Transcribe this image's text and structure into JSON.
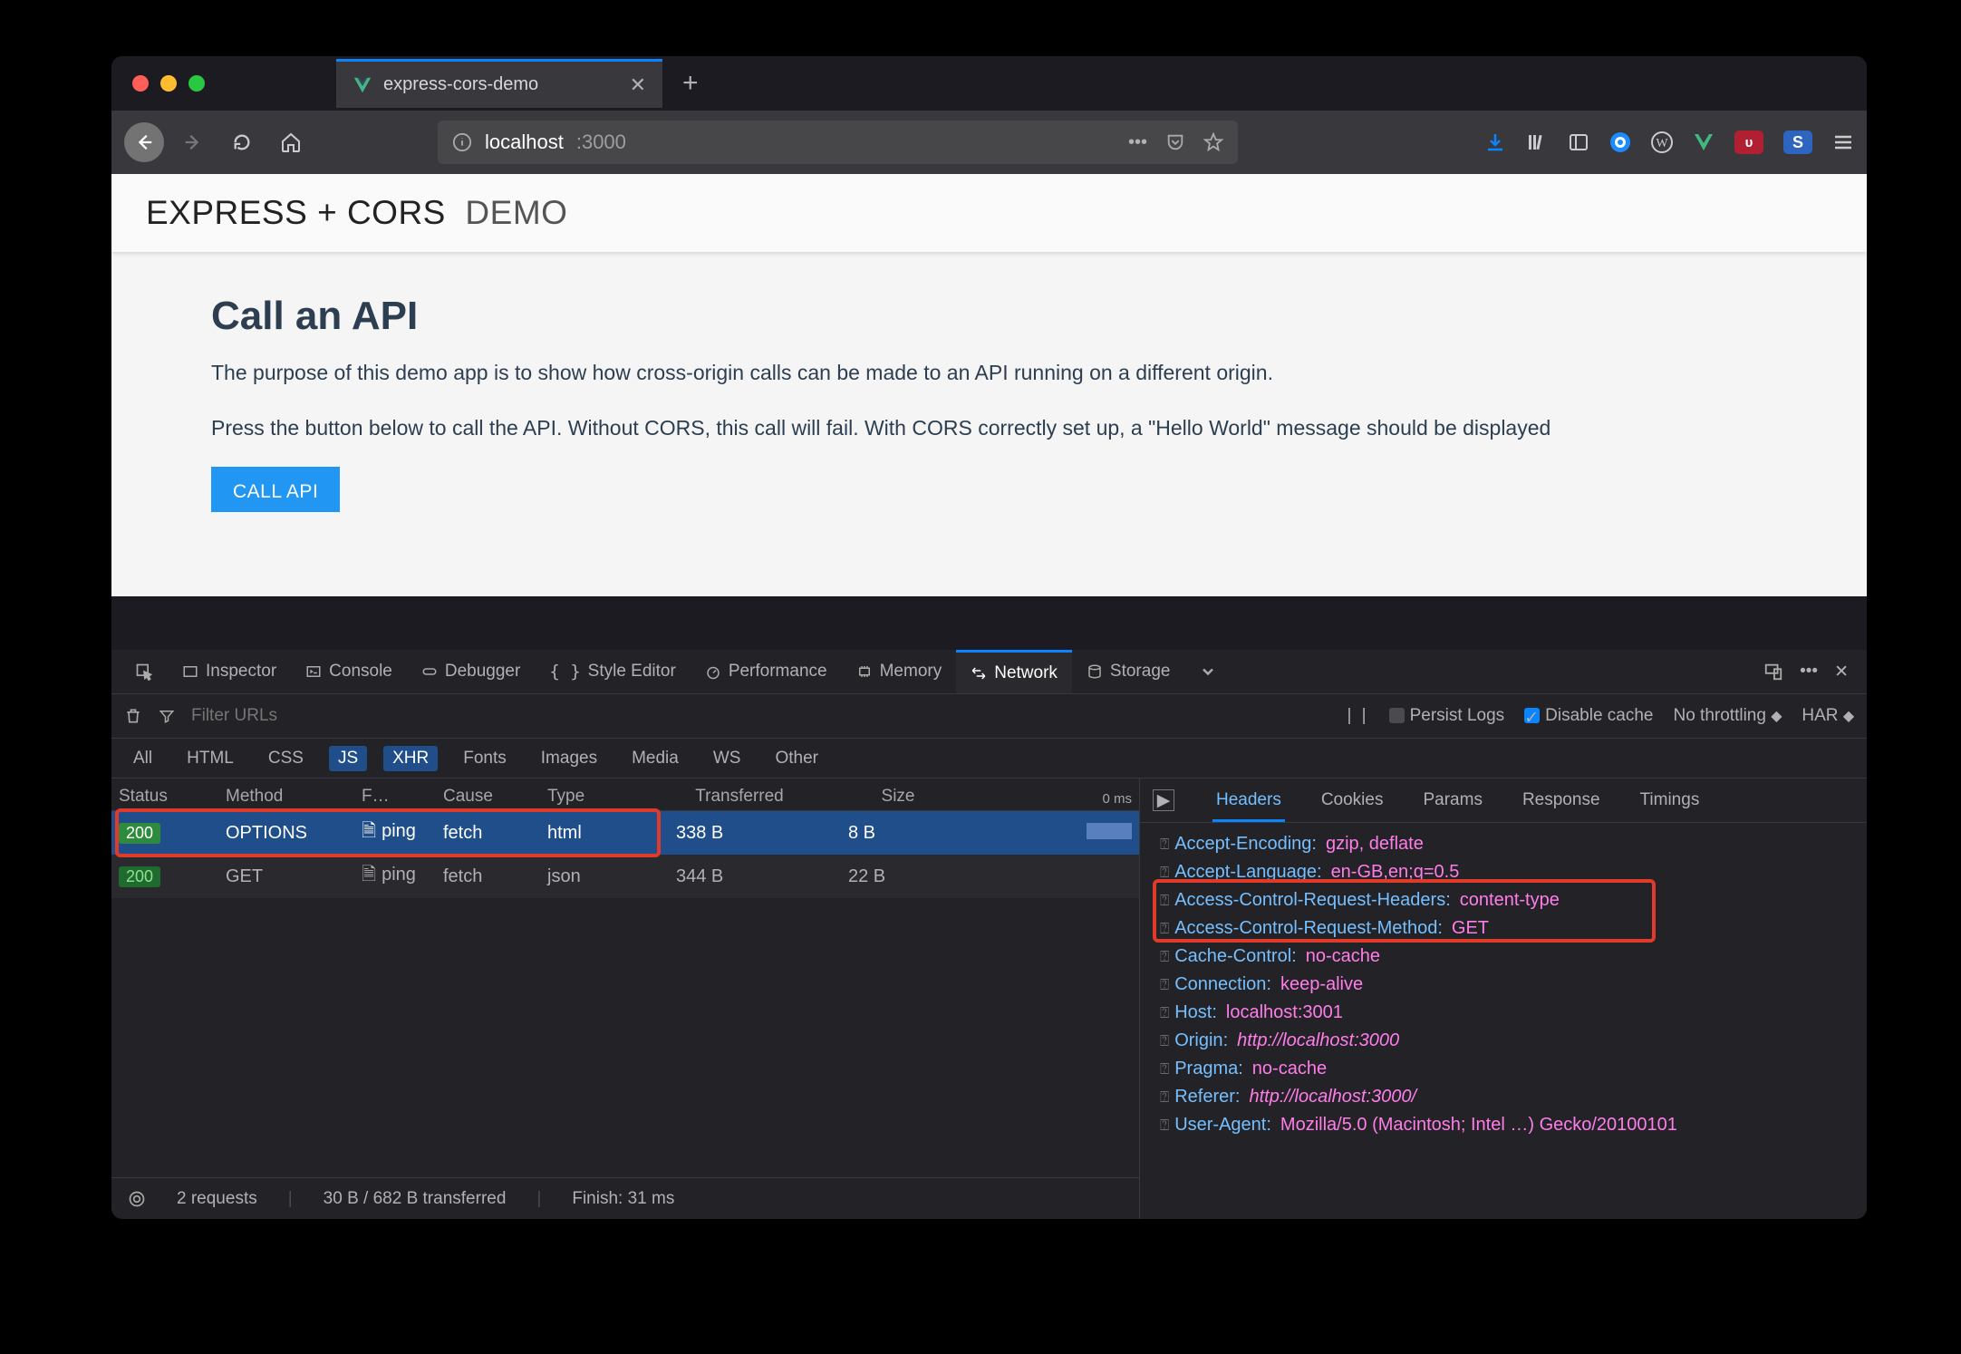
{
  "tab": {
    "title": "express-cors-demo"
  },
  "url": {
    "host": "localhost",
    "port": ":3000"
  },
  "page": {
    "brand_a": "EXPRESS + CORS",
    "brand_b": "DEMO",
    "heading": "Call an API",
    "p1": "The purpose of this demo app is to show how cross-origin calls can be made to an API running on a different origin.",
    "p2": "Press the button below to call the API. Without CORS, this call will fail. With CORS correctly set up, a \"Hello World\" message should be displayed",
    "button": "CALL API"
  },
  "devtools": {
    "tabs": [
      "Inspector",
      "Console",
      "Debugger",
      "Style Editor",
      "Performance",
      "Memory",
      "Network",
      "Storage"
    ],
    "filter_placeholder": "Filter URLs",
    "persist": "Persist Logs",
    "disable_cache": "Disable cache",
    "throttling": "No throttling",
    "har": "HAR",
    "chips": [
      "All",
      "HTML",
      "CSS",
      "JS",
      "XHR",
      "Fonts",
      "Images",
      "Media",
      "WS",
      "Other"
    ],
    "cols": {
      "status": "Status",
      "method": "Method",
      "file": "F…",
      "cause": "Cause",
      "type": "Type",
      "xfer": "Transferred",
      "size": "Size",
      "tl": "0 ms"
    },
    "rows": [
      {
        "status": "200",
        "method": "OPTIONS",
        "file": "ping",
        "cause": "fetch",
        "type": "html",
        "xfer": "338 B",
        "size": "8 B"
      },
      {
        "status": "200",
        "method": "GET",
        "file": "ping",
        "cause": "fetch",
        "type": "json",
        "xfer": "344 B",
        "size": "22 B"
      }
    ],
    "detail_tabs": [
      "Headers",
      "Cookies",
      "Params",
      "Response",
      "Timings"
    ],
    "headers": [
      {
        "k": "Accept-Encoding",
        "v": "gzip, deflate"
      },
      {
        "k": "Accept-Language",
        "v": "en-GB,en;q=0.5"
      },
      {
        "k": "Access-Control-Request-Headers",
        "v": "content-type"
      },
      {
        "k": "Access-Control-Request-Method",
        "v": "GET"
      },
      {
        "k": "Cache-Control",
        "v": "no-cache"
      },
      {
        "k": "Connection",
        "v": "keep-alive"
      },
      {
        "k": "Host",
        "v": "localhost:3001"
      },
      {
        "k": "Origin",
        "v": "http://localhost:3000"
      },
      {
        "k": "Pragma",
        "v": "no-cache"
      },
      {
        "k": "Referer",
        "v": "http://localhost:3000/"
      },
      {
        "k": "User-Agent",
        "v": "Mozilla/5.0 (Macintosh; Intel …) Gecko/20100101"
      }
    ],
    "status": {
      "requests": "2 requests",
      "transferred": "30 B / 682 B transferred",
      "finish": "Finish: 31 ms"
    }
  }
}
